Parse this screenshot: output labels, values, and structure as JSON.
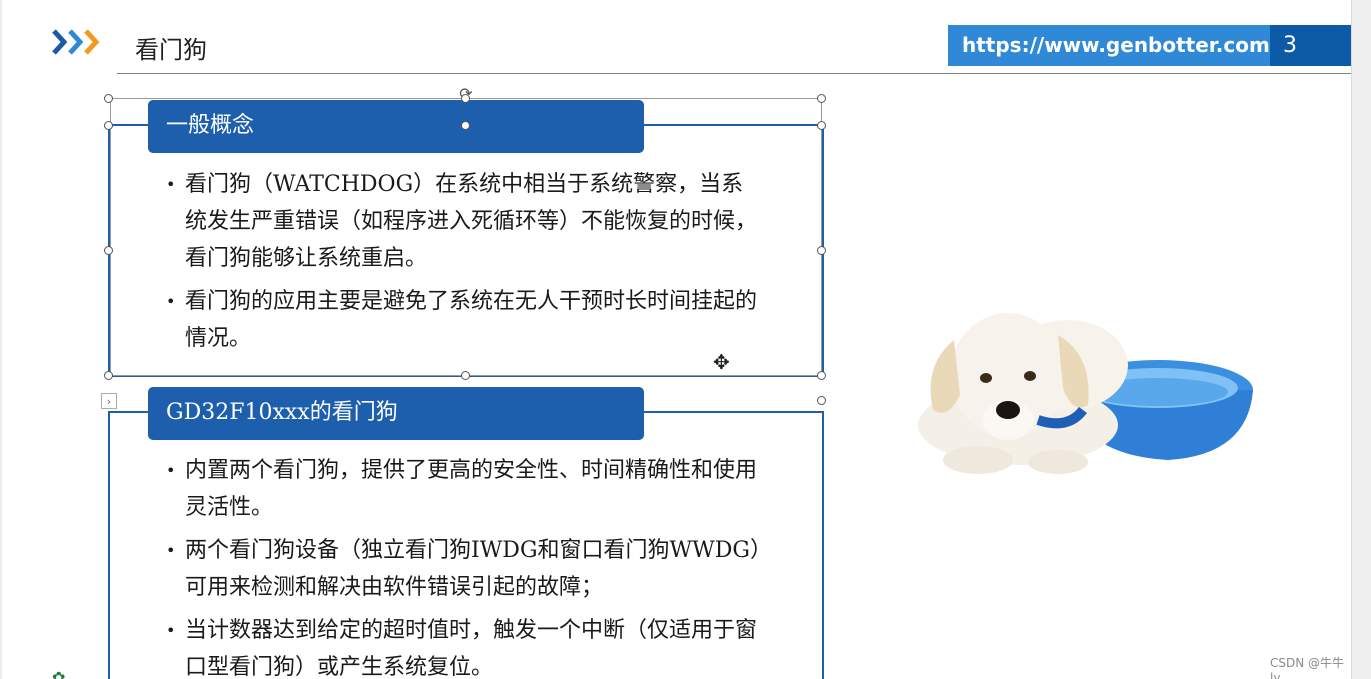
{
  "header": {
    "title": "看门狗",
    "url": "https://www.genbotter.com",
    "page_number": "3"
  },
  "section1": {
    "title": "一般概念",
    "bullets": [
      "看门狗（WATCHDOG）在系统中相当于系统警察，当系统发生严重错误（如程序进入死循环等）不能恢复的时候，看门狗能够让系统重启。",
      "看门狗的应用主要是避免了系统在无人干预时长时间挂起的情况。"
    ]
  },
  "section2": {
    "title": "GD32F10xxx的看门狗",
    "bullets": [
      "内置两个看门狗，提供了更高的安全性、时间精确性和使用灵活性。",
      "两个看门狗设备（独立看门狗IWDG和窗口看门狗WWDG）可用来检测和解决由软件错误引起的故障；",
      "当计数器达到给定的超时值时，触发一个中断（仅适用于窗口型看门狗）或产生系统复位。"
    ]
  },
  "watermark": "CSDN @牛牛ly",
  "colors": {
    "accent_dark": "#1d5fac",
    "accent_light": "#2f89d7",
    "logo_blue": "#1b5aa6",
    "logo_orange": "#f39a1c"
  },
  "icons": {
    "logo": "chevrons-logo",
    "rotate": "rotate-handle-icon",
    "cursor": "move-cursor-icon",
    "image": "dog-with-bowl-image"
  }
}
